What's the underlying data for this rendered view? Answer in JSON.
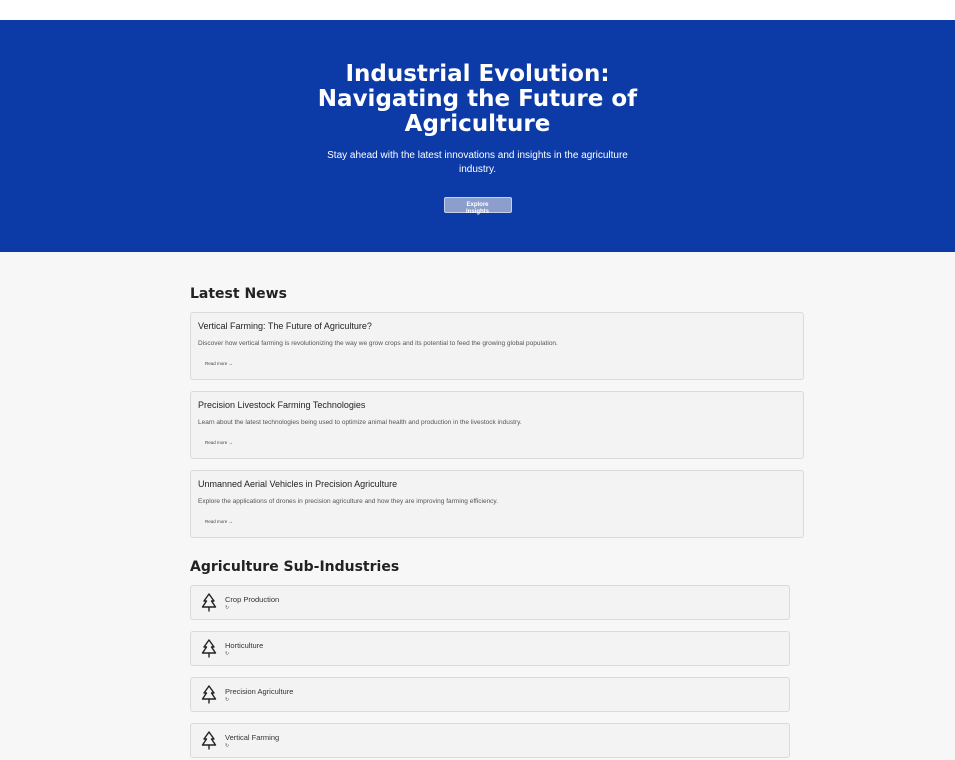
{
  "hero": {
    "title": "Industrial Evolution: Navigating the Future of Agriculture",
    "subtitle": "Stay ahead with the latest innovations and insights in the agriculture industry.",
    "cta_label": "Explore Insights"
  },
  "news": {
    "heading": "Latest News",
    "items": [
      {
        "title": "Vertical Farming: The Future of Agriculture?",
        "summary": "Discover how vertical farming is revolutionizing the way we grow crops and its potential to feed the growing global population.",
        "link": "Read more →"
      },
      {
        "title": "Precision Livestock Farming Technologies",
        "summary": "Learn about the latest technologies being used to optimize animal health and production in the livestock industry.",
        "link": "Read more →"
      },
      {
        "title": "Unmanned Aerial Vehicles in Precision Agriculture",
        "summary": "Explore the applications of drones in precision agriculture and how they are improving farming efficiency.",
        "link": "Read more →"
      }
    ]
  },
  "subindustries": {
    "heading": "Agriculture Sub-Industries",
    "items": [
      {
        "icon": "tree-icon",
        "label": "Crop Production",
        "mini": "↻"
      },
      {
        "icon": "tree-icon",
        "label": "Horticulture",
        "mini": "↻"
      },
      {
        "icon": "tree-icon",
        "label": "Precision Agriculture",
        "mini": "↻"
      },
      {
        "icon": "tree-icon",
        "label": "Vertical Farming",
        "mini": "↻"
      }
    ]
  },
  "colors": {
    "hero_bg": "#0c3ba8",
    "page_bg": "#f7f7f7",
    "card_bg": "#f3f3f3"
  }
}
